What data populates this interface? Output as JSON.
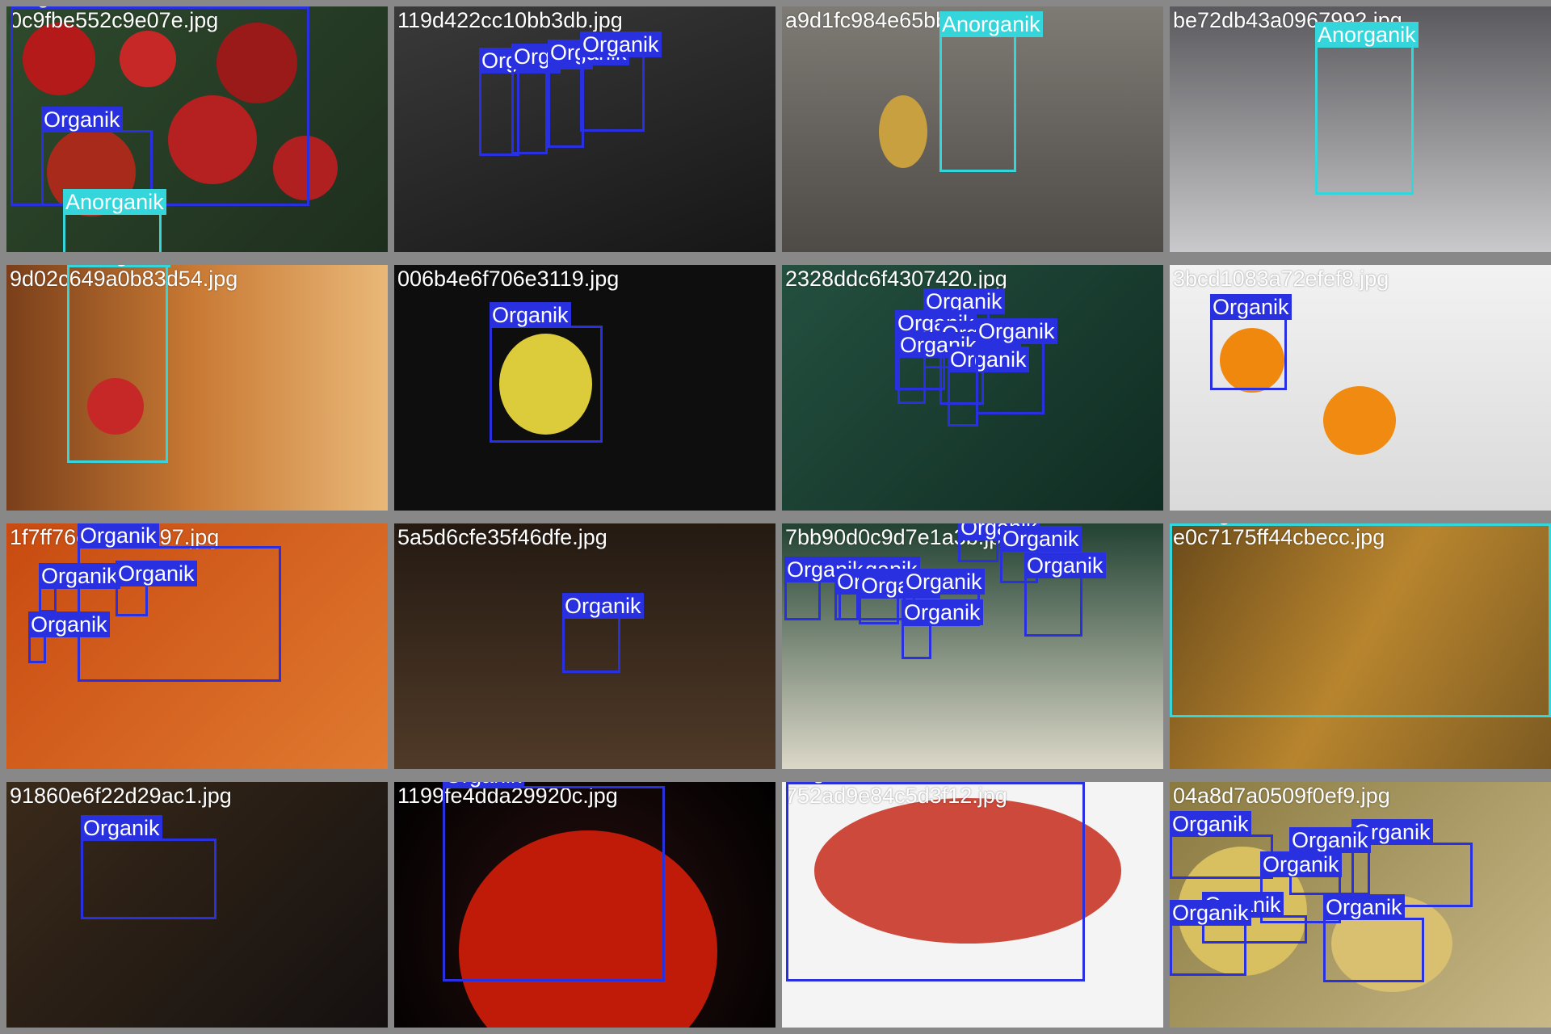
{
  "colors": {
    "organik": "#2830e0",
    "anorganik": "#34d6dc",
    "background": "#888888"
  },
  "tiles": [
    {
      "filename": "0c9fbe552c9e07e.jpg",
      "bg": "linear-gradient(135deg,#2e4a2c,#1e2e1e)"
    },
    {
      "filename": "119d422cc10bb3db.jpg",
      "bg": "linear-gradient(160deg,#3a3a3a,#161616)"
    },
    {
      "filename": "a9d1fc984e65bbe5.jpg",
      "bg": "linear-gradient(180deg,#7e7a74,#4e4a46)"
    },
    {
      "filename": "be72db43a0967992.jpg",
      "bg": "linear-gradient(180deg,#5a5a5e,#c9c9cc)"
    },
    {
      "filename": "9d02c649a0b83d54.jpg",
      "bg": "linear-gradient(90deg,#7a3f1a,#c97a34,#e9b878)"
    },
    {
      "filename": "006b4e6f706e3119.jpg",
      "bg": "#0e0e0e"
    },
    {
      "filename": "2328ddc6f4307420.jpg",
      "bg": "linear-gradient(135deg,#245040,#102c22)"
    },
    {
      "filename": "3bcd1083a72efef8.jpg",
      "bg": "linear-gradient(180deg,#f2f2f2,#dadada)"
    },
    {
      "filename": "1f7ff76e0bd5c997.jpg",
      "bg": "linear-gradient(135deg,#c84a10,#e07a30)"
    },
    {
      "filename": "5a5d6cfe35f46dfe.jpg",
      "bg": "linear-gradient(180deg,#241a12,#503a28)"
    },
    {
      "filename": "7bb90d0c9d7e1a3b.jpg",
      "bg": "linear-gradient(180deg,#224232,#dcd8c8)"
    },
    {
      "filename": "e0c7175ff44cbecc.jpg",
      "bg": "linear-gradient(120deg,#6a4a1a,#b8852e,#7c5a22)"
    },
    {
      "filename": "91860e6f22d29ac1.jpg",
      "bg": "linear-gradient(135deg,#3a2a1a,#141010)"
    },
    {
      "filename": "1199fe4dda29920c.jpg",
      "bg": "radial-gradient(circle at 50% 60%,#2a1010,#000000)"
    },
    {
      "filename": "752ad9e84c5d3f12.jpg",
      "bg": "#f4f4f4"
    },
    {
      "filename": "04a8d7a0509f0ef9.jpg",
      "bg": "linear-gradient(135deg,#8a7a40,#c8b888)"
    }
  ],
  "labels": {
    "organik": "Organik",
    "anorganik": "Anorganik"
  }
}
